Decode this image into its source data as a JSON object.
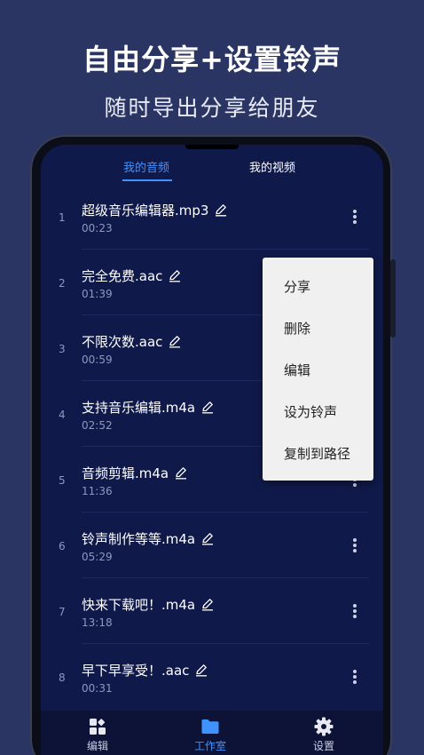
{
  "promo": {
    "title": "自由分享+设置铃声",
    "subtitle": "随时导出分享给朋友"
  },
  "tabs": [
    {
      "label": "我的音频",
      "active": true
    },
    {
      "label": "我的视频",
      "active": false
    }
  ],
  "files": [
    {
      "index": "1",
      "name": "超级音乐编辑器.mp3",
      "duration": "00:23"
    },
    {
      "index": "2",
      "name": "完全免费.aac",
      "duration": "01:39"
    },
    {
      "index": "3",
      "name": "不限次数.aac",
      "duration": "00:59"
    },
    {
      "index": "4",
      "name": "支持音乐编辑.m4a",
      "duration": "02:52"
    },
    {
      "index": "5",
      "name": "音频剪辑.m4a",
      "duration": "11:36"
    },
    {
      "index": "6",
      "name": "铃声制作等等.m4a",
      "duration": "05:29"
    },
    {
      "index": "7",
      "name": "快来下载吧！.m4a",
      "duration": "13:18"
    },
    {
      "index": "8",
      "name": "早下早享受！.aac",
      "duration": "00:31"
    }
  ],
  "context_menu": {
    "items": [
      "分享",
      "删除",
      "编辑",
      "设为铃声",
      "复制到路径"
    ]
  },
  "bottom_nav": [
    {
      "label": "编辑",
      "icon": "grid-plus-icon",
      "active": false
    },
    {
      "label": "工作室",
      "icon": "folder-icon",
      "active": true
    },
    {
      "label": "设置",
      "icon": "gear-icon",
      "active": false
    }
  ],
  "colors": {
    "background": "#2a3563",
    "screen": "#101a4a",
    "accent": "#3f93ff",
    "menu_background": "#f0f0f0"
  }
}
